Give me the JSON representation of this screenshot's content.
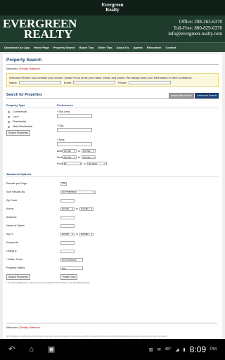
{
  "app": {
    "title_line1": "Evergreen",
    "title_line2": "Realty"
  },
  "header": {
    "logo_line1": "EVERGREEN",
    "logo_line2": "REALTY",
    "office": "Office: 208-263-6370",
    "tollfree": "Toll-Free: 800-829-6370",
    "email": "info@evergreen-realty.com"
  },
  "nav": [
    "Download Our App",
    "Home Page",
    "Property Search",
    "Buyer Tips",
    "Seller Tips",
    "About Us",
    "Agents",
    "Relocation",
    "Contact"
  ],
  "property_search": {
    "title": "Property Search",
    "welcome": "Welcome",
    "welcome_name": "Realty Watcher!",
    "notice_text": "Welcome! Before you continue your search, please let us know your name, email, and phone. We always keep your information in strict confidence.",
    "name_label": "Name:",
    "email_label": "Email:",
    "phone_label": "Phone:"
  },
  "search_for_properties": {
    "title": "Search for Properties",
    "tab_instant": "Instant Map Search",
    "tab_advanced": "Advanced Search"
  },
  "property_type": {
    "title": "Property Type",
    "options": [
      "Commercial",
      "Land",
      "Residential",
      "Multi-Residential"
    ],
    "button": "Search Properties"
  },
  "preferences": {
    "title": "Preferences",
    "sub_area_label": "* Sub Area",
    "city_label": "* City:",
    "area_label": "* Area:",
    "baths_label": "Baths:",
    "beds_label": "Beds:",
    "price_label": "Price:",
    "no_min": "No Min",
    "no_max": "No Max",
    "price_min": "$0",
    "price_max": "No Limit",
    "to": "to"
  },
  "advanced": {
    "title": "Advanced Options",
    "results_per_page_label": "Results per Page:",
    "results_per_page_value": "10",
    "sort_label": "Sort Results By:",
    "sort_value": "No Preference",
    "zip_label": "Zip Code:",
    "acres_label": "Acres:",
    "address_label": "Address:",
    "street_label": "Name of Street:",
    "sqft_label": "Sq Ft:",
    "keywords_label": "Keywords:",
    "listing_label": "Listing #:",
    "waterfront_label": "* Water Front:",
    "waterfront_value": "No Preference",
    "status_label": "Property Status:",
    "status_value": "Any",
    "no_min": "No Min",
    "no_max": "No Max",
    "to": "to",
    "search_button": "Search Properties",
    "reset_button": "Reset Form",
    "note": "* To select multiple areas, cities, sub areas or waterfront hold Ctrl key on the key while selecting."
  },
  "footer": {
    "welcome": "Welcome",
    "welcome_name": "Realty Watcher!",
    "fine_print": "All information is provided as is and for consumer's personal, non-commercial use. It may not be used for any purpose other than to identify prospective properties consumers may be interested in purchasing."
  },
  "system": {
    "battery": "48°",
    "time": "8:09",
    "ampm": "PM"
  }
}
